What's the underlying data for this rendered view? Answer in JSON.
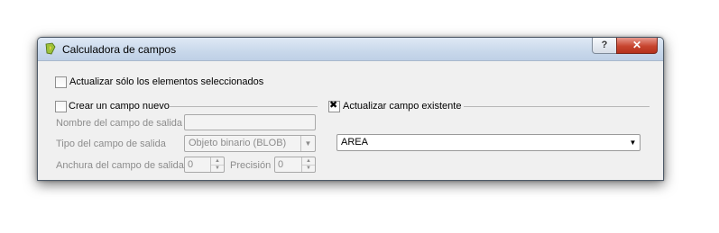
{
  "window": {
    "title": "Calculadora de campos",
    "help_label": "?",
    "close_label": "✕"
  },
  "options": {
    "update_selected_label": "Actualizar sólo los elementos seleccionados",
    "update_selected_checked": false
  },
  "new_field": {
    "checkbox_label": "Crear un campo nuevo",
    "checked": false,
    "output_name_label": "Nombre del campo de salida",
    "output_name_value": "",
    "output_type_label": "Tipo del campo de salida",
    "output_type_value": "Objeto binario (BLOB)",
    "output_width_label": "Anchura del campo de salida",
    "output_width_value": "0",
    "precision_label": "Precisión",
    "precision_value": "0"
  },
  "existing_field": {
    "checkbox_label": "Actualizar campo existente",
    "checked": true,
    "selected_field": "AREA"
  },
  "icons": {
    "app": "qgis-icon",
    "dropdown": "chevron-down-icon",
    "spin_up": "triangle-up-icon",
    "spin_down": "triangle-down-icon"
  },
  "colors": {
    "title_bar": "#c9d8eb",
    "close_button": "#c7452f",
    "disabled_text": "#8c8c8c"
  }
}
